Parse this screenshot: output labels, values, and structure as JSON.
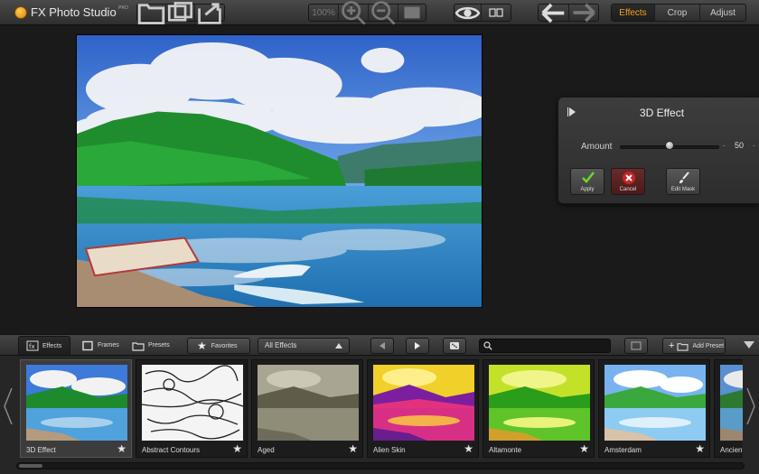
{
  "app": {
    "title": "FX Photo Studio",
    "title_sup": "PRO"
  },
  "toolbar": {
    "zoom_value": "100%",
    "mode_tabs": [
      {
        "label": "Effects",
        "active": true
      },
      {
        "label": "Crop",
        "active": false
      },
      {
        "label": "Adjust",
        "active": false
      }
    ],
    "icons": [
      "open-folder-icon",
      "browse-icon",
      "share-icon",
      "zoom-in-icon",
      "zoom-out-icon",
      "fit-screen-icon",
      "preview-eye-icon",
      "compare-icon",
      "undo-icon",
      "redo-icon"
    ]
  },
  "effect_panel": {
    "title": "3D Effect",
    "amount_label": "Amount",
    "amount_value": "50",
    "amount_level": 0.5,
    "buttons": {
      "apply": "Apply",
      "cancel": "Cancel",
      "edit_mask": "Edit Mask"
    }
  },
  "bottom_bar": {
    "tabs": [
      {
        "label": "Effects",
        "active": true
      },
      {
        "label": "Frames",
        "active": false
      },
      {
        "label": "Presets",
        "active": false
      }
    ],
    "favorites_label": "Favorites",
    "filter_value": "All Effects",
    "search_placeholder": "",
    "add_preset_label": "Add Preset"
  },
  "thumbnails": [
    {
      "label": "3D Effect",
      "style": "3d",
      "selected": true
    },
    {
      "label": "Abstract Contours",
      "style": "contours",
      "selected": false
    },
    {
      "label": "Aged",
      "style": "aged",
      "selected": false
    },
    {
      "label": "Alien Skin",
      "style": "alien",
      "selected": false
    },
    {
      "label": "Altamonte",
      "style": "altamonte",
      "selected": false
    },
    {
      "label": "Amsterdam",
      "style": "amsterdam",
      "selected": false
    },
    {
      "label": "Ancient",
      "style": "normal",
      "selected": false
    }
  ],
  "colors": {
    "accent": "#f2a51a",
    "panel_bg": "#2d2d2d"
  }
}
